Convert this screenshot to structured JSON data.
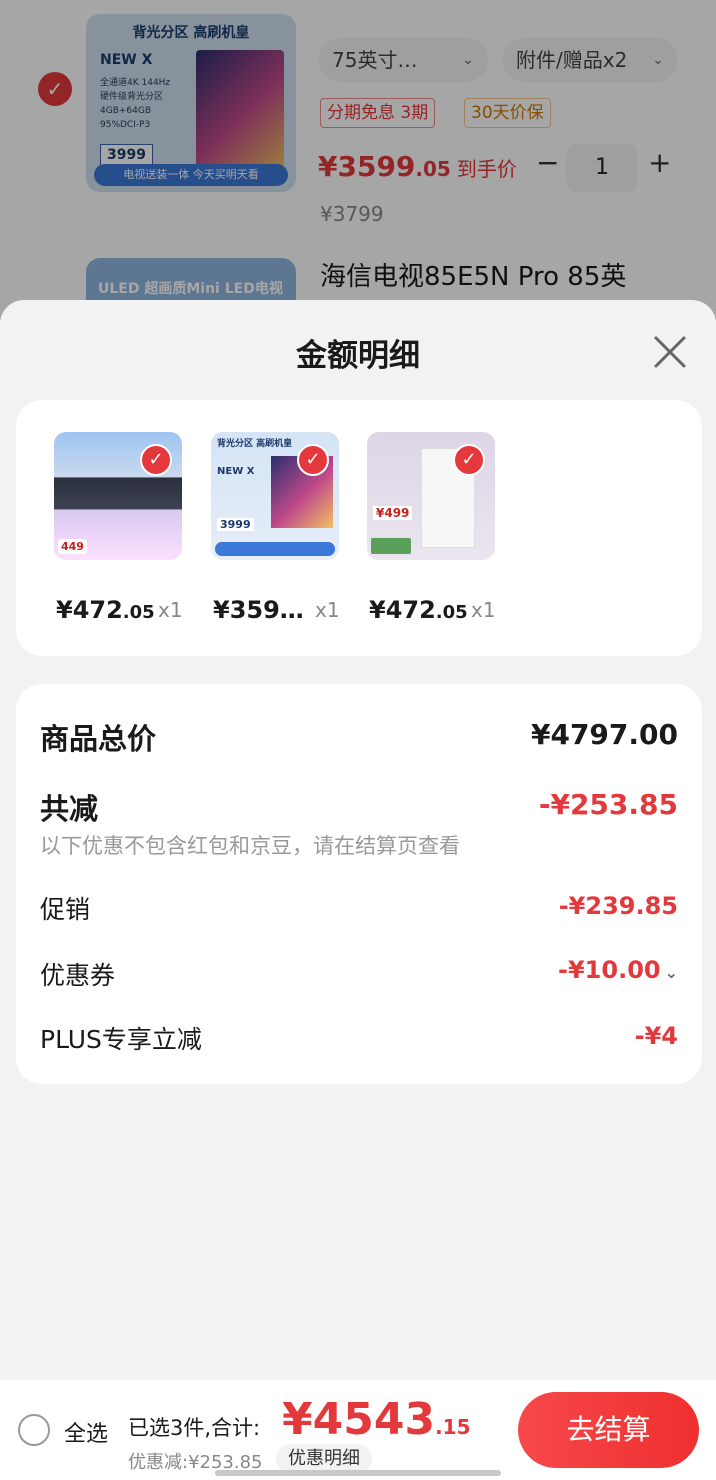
{
  "background_cart": {
    "option_size": "75英寸…",
    "option_accessory": "附件/赠品x2",
    "tag_installment": "分期免息",
    "tag_installment_periods": "3期",
    "tag_price_protect": "30天价保",
    "price_main": "¥3599",
    "price_decimal": ".05",
    "price_suffix": "到手价",
    "quantity": "1",
    "original_price": "¥3799",
    "next_item_name": "海信电视85E5N Pro 85英",
    "thumb_title": "背光分区 高刷机皇",
    "thumb_model": "NEW X",
    "thumb_specs": [
      "全通道4K 144Hz",
      "硬件级背光分区",
      "4GB+64GB",
      "95%DCI-P3"
    ],
    "thumb_price": "3999",
    "thumb_banner": "电视送装一体  今天买明天看",
    "thumb2_label": "ULED 超画质Mini LED电视"
  },
  "sheet": {
    "title": "金额明细",
    "items": [
      {
        "price_main": "¥472",
        "price_decimal": ".05",
        "qty": "x1",
        "img_badge": "449"
      },
      {
        "price_main": "¥359…",
        "price_decimal": "",
        "qty": "x1",
        "img_title": "背光分区 高刷机皇",
        "img_model": "NEW X",
        "img_price": "3999"
      },
      {
        "price_main": "¥472",
        "price_decimal": ".05",
        "qty": "x1",
        "img_price": "¥499"
      }
    ],
    "summary": {
      "total_label": "商品总价",
      "total_value": "¥4797.00",
      "reduce_label": "共减",
      "reduce_value": "-¥253.85",
      "note": "以下优惠不包含红包和京豆，请在结算页查看",
      "promo_label": "促销",
      "promo_value": "-¥239.85",
      "coupon_label": "优惠券",
      "coupon_value": "-¥10.00",
      "plus_label": "PLUS专享立减",
      "plus_value": "-¥4"
    }
  },
  "bottom_bar": {
    "select_all": "全选",
    "selected_info": "已选3件,合计:",
    "total_main": "¥4543",
    "total_decimal": ".15",
    "discount": "优惠减:¥253.85",
    "detail_link": "优惠明细",
    "checkout": "去结算"
  },
  "colors": {
    "accent": "#e4393c",
    "background": "#f2f2f2"
  }
}
